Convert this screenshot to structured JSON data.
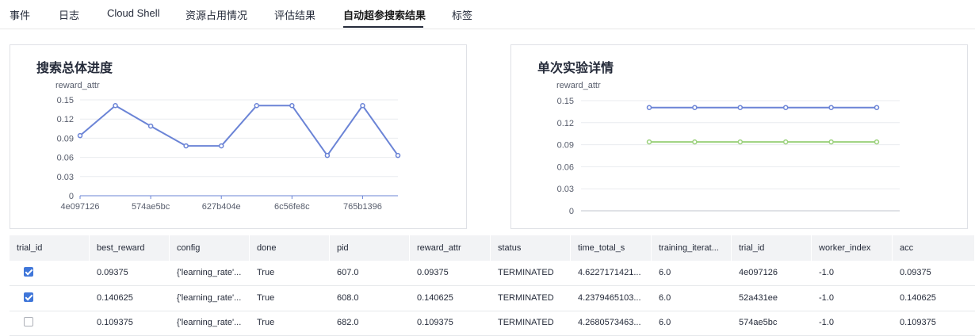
{
  "tabs": [
    {
      "label": "事件"
    },
    {
      "label": "日志"
    },
    {
      "label": "Cloud Shell"
    },
    {
      "label": "资源占用情况"
    },
    {
      "label": "评估结果"
    },
    {
      "label": "自动超参搜索结果",
      "active": true
    },
    {
      "label": "标签"
    }
  ],
  "colors": {
    "series_blue": "#6b84d6",
    "series_green": "#9bd17c",
    "checkbox": "#3f76d9"
  },
  "charts": {
    "left": {
      "title": "搜索总体进度",
      "ylabel": "reward_attr",
      "yticks": [
        "0",
        "0.03",
        "0.06",
        "0.09",
        "0.12",
        "0.15"
      ],
      "xticks": [
        "4e097126",
        "574ae5bc",
        "627b404e",
        "6c56fe8c",
        "765b1396"
      ]
    },
    "right": {
      "title": "单次实验详情",
      "ylabel": "reward_attr",
      "yticks": [
        "0",
        "0.03",
        "0.06",
        "0.09",
        "0.12",
        "0.15"
      ]
    }
  },
  "chart_data": [
    {
      "type": "line",
      "title": "搜索总体进度",
      "ylabel": "reward_attr",
      "ylim": [
        0,
        0.15
      ],
      "x": [
        0,
        1,
        2,
        3,
        4,
        5,
        6,
        7,
        8,
        9
      ],
      "xtick_labels": [
        "4e097126",
        "574ae5bc",
        "627b404e",
        "6c56fe8c",
        "765b1396"
      ],
      "series": [
        {
          "values": [
            0.094,
            0.141,
            0.109,
            0.078,
            0.078,
            0.141,
            0.141,
            0.063,
            0.141,
            0.063
          ]
        }
      ]
    },
    {
      "type": "line",
      "title": "单次实验详情",
      "ylabel": "reward_attr",
      "ylim": [
        0,
        0.15
      ],
      "x": [
        0,
        1,
        2,
        3,
        4,
        5
      ],
      "series": [
        {
          "values": [
            0.140625,
            0.140625,
            0.140625,
            0.140625,
            0.140625,
            0.140625
          ]
        },
        {
          "values": [
            0.09375,
            0.09375,
            0.09375,
            0.09375,
            0.09375,
            0.09375
          ]
        }
      ]
    }
  ],
  "table": {
    "columns": [
      "trial_id",
      "best_reward",
      "config",
      "done",
      "pid",
      "reward_attr",
      "status",
      "time_total_s",
      "training_iterat...",
      "trial_id",
      "worker_index",
      "acc"
    ],
    "rows": [
      {
        "checked": true,
        "cells": [
          "0.09375",
          "{'learning_rate'...",
          "True",
          "607.0",
          "0.09375",
          "TERMINATED",
          "4.6227171421...",
          "6.0",
          "4e097126",
          "-1.0",
          "0.09375"
        ]
      },
      {
        "checked": true,
        "cells": [
          "0.140625",
          "{'learning_rate'...",
          "True",
          "608.0",
          "0.140625",
          "TERMINATED",
          "4.2379465103...",
          "6.0",
          "52a431ee",
          "-1.0",
          "0.140625"
        ]
      },
      {
        "checked": false,
        "cells": [
          "0.109375",
          "{'learning_rate'...",
          "True",
          "682.0",
          "0.109375",
          "TERMINATED",
          "4.2680573463...",
          "6.0",
          "574ae5bc",
          "-1.0",
          "0.109375"
        ]
      }
    ]
  }
}
